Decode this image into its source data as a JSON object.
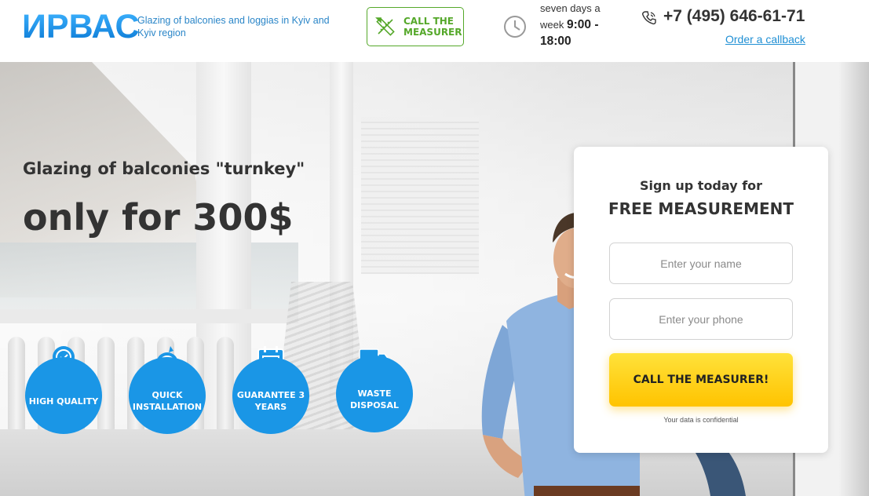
{
  "header": {
    "logo": "ИРВАС",
    "tagline": "Glazing of balconies and loggias in Kyiv and Kyiv region",
    "measurer_button": "CALL THE MEASURER",
    "hours_prefix": "seven days a week",
    "hours_time": "9:00 - 18:00",
    "phone": "+7 (495) 646-61-71",
    "callback_link": "Order a callback"
  },
  "hero": {
    "title_line1": "Glazing of balconies \"turnkey\"",
    "title_line2": "only for 300$",
    "features": [
      {
        "icon": "award-ribbon-icon",
        "label": "HIGH QUALITY"
      },
      {
        "icon": "stopwatch-icon",
        "label": "QUICK INSTALLATION"
      },
      {
        "icon": "calendar-star-icon",
        "label": "GUARANTEE 3 YEARS"
      },
      {
        "icon": "truck-icon",
        "label": "WASTE DISPOSAL"
      }
    ]
  },
  "form": {
    "subtitle": "Sign up today for",
    "title": "FREE MEASUREMENT",
    "name_placeholder": "Enter your name",
    "phone_placeholder": "Enter your phone",
    "submit_label": "CALL THE MEASURER!",
    "note": "Your data is confidential"
  },
  "colors": {
    "accent_blue": "#1a96e6",
    "green": "#55a82a",
    "yellow": "#ffc300",
    "link_blue": "#1f8fd4"
  }
}
